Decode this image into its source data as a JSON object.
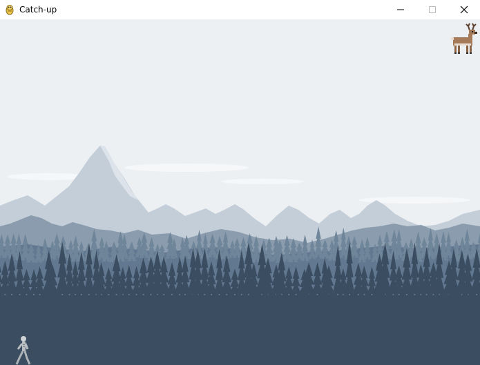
{
  "window": {
    "title": "Catch-up",
    "app_icon": "pygame-snake-icon",
    "controls": [
      "minimize-icon",
      "maximize-icon",
      "close-icon"
    ]
  },
  "game": {
    "player": "deer-sprite",
    "chaser": "skeleton-sprite",
    "colors": {
      "sky": "#edf0f3",
      "far_mountains": "#c4ced8",
      "mid_mountains": "#8a9cad",
      "near_hills": "#617890",
      "forest": "#3b4d60"
    }
  }
}
